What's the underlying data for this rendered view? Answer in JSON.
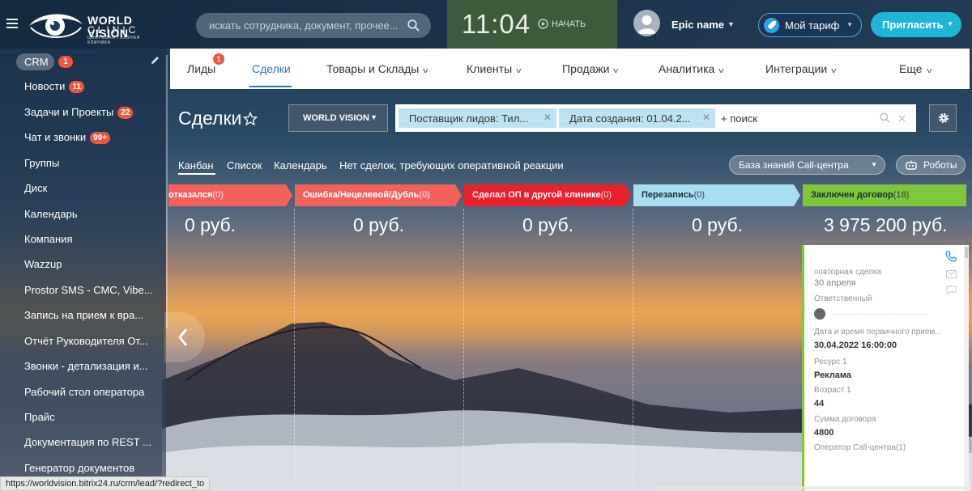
{
  "brand": {
    "name": "WORLD VISION",
    "sub": "CLINIC",
    "tagline": "ЦИФРОВАЯ ГЛАЗНАЯ КЛИНИКА"
  },
  "search": {
    "placeholder": "искать сотрудника, документ, прочее..."
  },
  "clock": {
    "time": "11:04",
    "start_label": "НАЧАТЬ"
  },
  "user": {
    "name": "Epic name"
  },
  "tariff": {
    "label": "Мой тариф"
  },
  "invite": {
    "label": "Пригласить"
  },
  "sidebar": {
    "crm": {
      "label": "CRM",
      "badge": "1"
    },
    "items": [
      {
        "label": "Новости",
        "badge": "11"
      },
      {
        "label": "Задачи и Проекты",
        "badge": "22"
      },
      {
        "label": "Чат и звонки",
        "badge": "99+"
      },
      {
        "label": "Группы",
        "badge": ""
      },
      {
        "label": "Диск",
        "badge": ""
      },
      {
        "label": "Календарь",
        "badge": ""
      },
      {
        "label": "Компания",
        "badge": ""
      },
      {
        "label": "Wazzup",
        "badge": ""
      },
      {
        "label": "Prostor SMS - СМС, Vibe...",
        "badge": ""
      },
      {
        "label": "Запись на прием к вра...",
        "badge": ""
      },
      {
        "label": "Отчёт Руководителя От...",
        "badge": ""
      },
      {
        "label": "Звонки - детализация и...",
        "badge": ""
      },
      {
        "label": "Рабочий стол оператора",
        "badge": ""
      },
      {
        "label": "Прайс",
        "badge": ""
      },
      {
        "label": "Документация по REST ...",
        "badge": ""
      },
      {
        "label": "Генератор документов",
        "badge": ""
      }
    ]
  },
  "tabs": [
    {
      "label": "Лиды",
      "badge": "1"
    },
    {
      "label": "Сделки"
    },
    {
      "label": "Товары и Склады"
    },
    {
      "label": "Клиенты"
    },
    {
      "label": "Продажи"
    },
    {
      "label": "Аналитика"
    },
    {
      "label": "Интеграции"
    },
    {
      "label": "Еще"
    }
  ],
  "page": {
    "title": "Сделки"
  },
  "org_button": {
    "label": "WORLD VISION"
  },
  "filter": {
    "chips": [
      "Поставщик лидов: Тил...",
      "Дата создания: 01.04.2..."
    ],
    "input": "+ поиск"
  },
  "views": [
    "Канбан",
    "Список",
    "Календарь",
    "Нет сделок, требующих оперативной реакции"
  ],
  "knowledge_base": {
    "label": "База знаний Call-центра"
  },
  "robots": {
    "label": "Роботы"
  },
  "stages": [
    {
      "name": "отказался",
      "count": "(0)",
      "sum": "0 руб.",
      "color": "#f2625a"
    },
    {
      "name": "Ошибка/Нецелевой/Дубль",
      "count": "(0)",
      "sum": "0 руб.",
      "color": "#f2625a"
    },
    {
      "name": "Сделал ОП в другой клинике",
      "count": "(0)",
      "sum": "0 руб.",
      "color": "#e8212a"
    },
    {
      "name": "Перезапись",
      "count": "(0)",
      "sum": "0 руб.",
      "color": "#a9ddf1"
    },
    {
      "name": "Заключен договор",
      "count": "(18)",
      "sum": "3 975 200 руб.",
      "color": "#7ec63a"
    }
  ],
  "card": {
    "title": "повторная сделка",
    "date": "30 апреля",
    "responsible_label": "Ответственный",
    "first_visit_label": "Дата и время первичного прием...",
    "first_visit_value": "30.04.2022 16:00:00",
    "resource_label": "Ресурс 1",
    "resource_value": "Реклама",
    "age_label": "Возраст 1",
    "age_value": "44",
    "contract_label": "Сумма договора",
    "contract_value": "4800",
    "operator_label": "Оператор Call-центра(1)"
  },
  "status_url": "https://worldvision.bitrix24.ru/crm/lead/?redirect_to"
}
